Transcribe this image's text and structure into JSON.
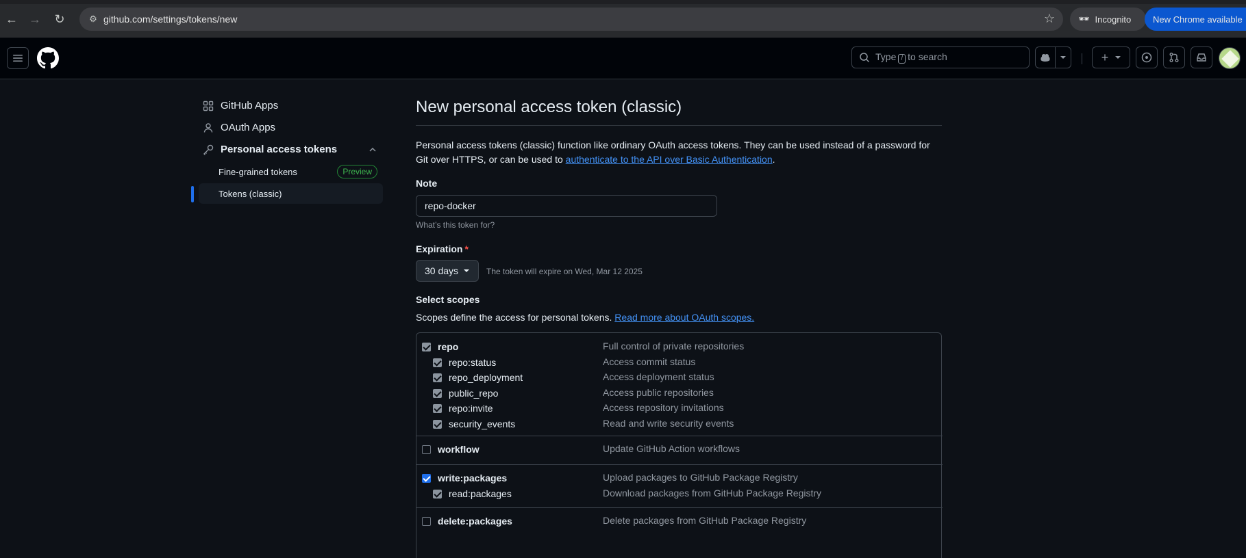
{
  "browser": {
    "url": "github.com/settings/tokens/new",
    "incognito_label": "Incognito",
    "update_label": "New Chrome available"
  },
  "header": {
    "search_prefix": "Type",
    "search_key": "/",
    "search_suffix": "to search"
  },
  "sidebar": {
    "items": [
      {
        "label": "GitHub Apps"
      },
      {
        "label": "OAuth Apps"
      },
      {
        "label": "Personal access tokens"
      }
    ],
    "sub_items": [
      {
        "label": "Fine-grained tokens",
        "badge": "Preview"
      },
      {
        "label": "Tokens (classic)"
      }
    ]
  },
  "main": {
    "title": "New personal access token (classic)",
    "description_before": "Personal access tokens (classic) function like ordinary OAuth access tokens. They can be used instead of a password for Git over HTTPS, or can be used to ",
    "description_link": "authenticate to the API over Basic Authentication",
    "description_after": ".",
    "note_label": "Note",
    "note_value": "repo-docker",
    "note_hint": "What’s this token for?",
    "expiration_label": "Expiration",
    "expiration_required": "*",
    "expiration_value": "30 days",
    "expiration_note": "The token will expire on Wed, Mar 12 2025",
    "scopes_label": "Select scopes",
    "scopes_desc": "Scopes define the access for personal tokens.",
    "scopes_link": "Read more about OAuth scopes."
  },
  "scopes": {
    "repo": {
      "name": "repo",
      "desc": "Full control of private repositories",
      "state": "checked-disabled"
    },
    "repo_status": {
      "name": "repo:status",
      "desc": "Access commit status",
      "state": "checked-disabled"
    },
    "repo_deployment": {
      "name": "repo_deployment",
      "desc": "Access deployment status",
      "state": "checked-disabled"
    },
    "public_repo": {
      "name": "public_repo",
      "desc": "Access public repositories",
      "state": "checked-disabled"
    },
    "repo_invite": {
      "name": "repo:invite",
      "desc": "Access repository invitations",
      "state": "checked-disabled"
    },
    "security_events": {
      "name": "security_events",
      "desc": "Read and write security events",
      "state": "checked-disabled"
    },
    "workflow": {
      "name": "workflow",
      "desc": "Update GitHub Action workflows",
      "state": "unchecked"
    },
    "write_packages": {
      "name": "write:packages",
      "desc": "Upload packages to GitHub Package Registry",
      "state": "checked"
    },
    "read_packages": {
      "name": "read:packages",
      "desc": "Download packages from GitHub Package Registry",
      "state": "checked-disabled"
    },
    "delete_packages": {
      "name": "delete:packages",
      "desc": "Delete packages from GitHub Package Registry",
      "state": "unchecked"
    }
  }
}
